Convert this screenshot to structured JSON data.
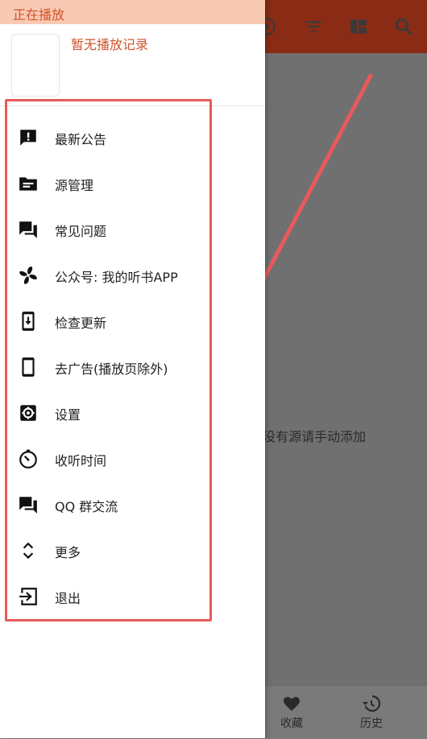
{
  "drawer": {
    "now_playing_label": "正在播放",
    "no_record_label": "暂无播放记录",
    "menu": [
      {
        "label": "最新公告",
        "icon": "announcement-icon"
      },
      {
        "label": "源管理",
        "icon": "folder-icon"
      },
      {
        "label": "常见问题",
        "icon": "forum-icon"
      },
      {
        "label": "公众号: 我的听书APP",
        "icon": "pinwheel-icon"
      },
      {
        "label": "检查更新",
        "icon": "system-update-icon"
      },
      {
        "label": "去广告(播放页除外)",
        "icon": "smartphone-icon"
      },
      {
        "label": "设置",
        "icon": "settings-icon"
      },
      {
        "label": "收听时间",
        "icon": "timer-icon"
      },
      {
        "label": "QQ 群交流",
        "icon": "forum-icon"
      },
      {
        "label": "更多",
        "icon": "unfold-more-icon"
      },
      {
        "label": "退出",
        "icon": "exit-icon"
      }
    ]
  },
  "main": {
    "hint_text": ", 若没有源请手动添加"
  },
  "bottom_nav": {
    "items": [
      {
        "label": "收藏",
        "icon": "heart-icon"
      },
      {
        "label": "历史",
        "icon": "history-icon"
      }
    ]
  },
  "colors": {
    "accent": "#d2532a",
    "annotation": "#e9595b",
    "appbar": "#8a2b16"
  }
}
